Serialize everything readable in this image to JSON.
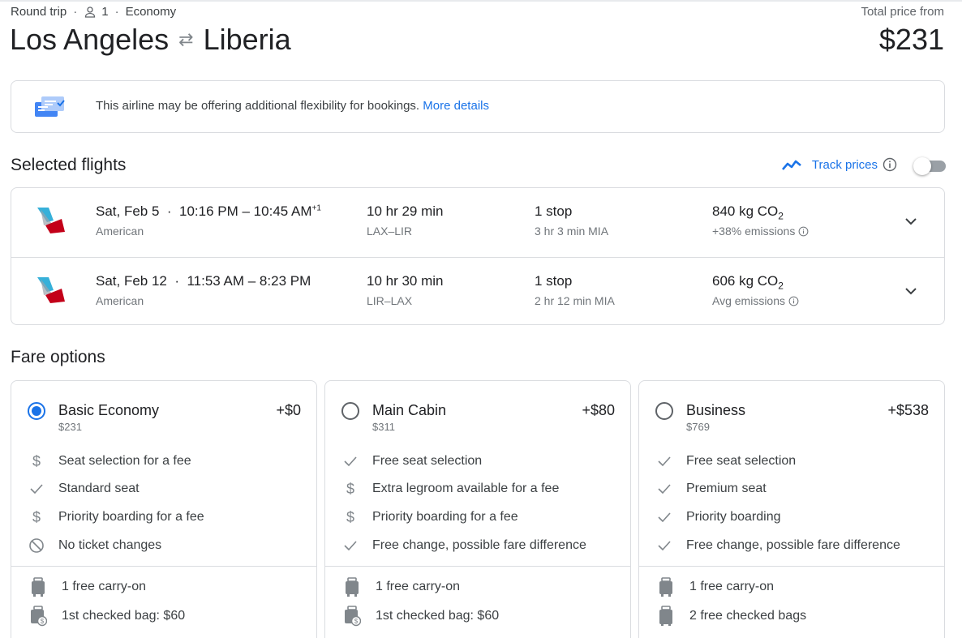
{
  "header": {
    "trip_type": "Round trip",
    "passengers": "1",
    "cabin": "Economy",
    "origin": "Los Angeles",
    "destination": "Liberia",
    "total_label": "Total price from",
    "total_price": "$231"
  },
  "banner": {
    "text": "This airline may be offering additional flexibility for bookings.",
    "link": "More details"
  },
  "selected_flights": {
    "title": "Selected flights",
    "track_label": "Track prices",
    "track_enabled": false,
    "flights": [
      {
        "date": "Sat, Feb 5",
        "times": "10:16 PM – 10:45 AM",
        "day_offset": "+1",
        "airline": "American",
        "duration": "10 hr 29 min",
        "route": "LAX–LIR",
        "stops": "1 stop",
        "layover": "3 hr 3 min MIA",
        "emissions_value": "840 kg CO",
        "emissions_sub": "2",
        "emissions_note": "+38% emissions"
      },
      {
        "date": "Sat, Feb 12",
        "times": "11:53 AM – 8:23 PM",
        "day_offset": "",
        "airline": "American",
        "duration": "10 hr 30 min",
        "route": "LIR–LAX",
        "stops": "1 stop",
        "layover": "2 hr 12 min MIA",
        "emissions_value": "606 kg CO",
        "emissions_sub": "2",
        "emissions_note": "Avg emissions"
      }
    ]
  },
  "fare_options": {
    "title": "Fare options",
    "fares": [
      {
        "name": "Basic Economy",
        "price": "$231",
        "delta": "+$0",
        "selected": true,
        "features": [
          {
            "icon": "dollar-icon",
            "text": "Seat selection for a fee"
          },
          {
            "icon": "check-icon",
            "text": "Standard seat"
          },
          {
            "icon": "dollar-icon",
            "text": "Priority boarding for a fee"
          },
          {
            "icon": "no-icon",
            "text": "No ticket changes"
          }
        ],
        "bags": [
          {
            "icon": "carry-on-icon",
            "text": "1 free carry-on"
          },
          {
            "icon": "checked-bag-fee-icon",
            "text": "1st checked bag: $60"
          }
        ]
      },
      {
        "name": "Main Cabin",
        "price": "$311",
        "delta": "+$80",
        "selected": false,
        "features": [
          {
            "icon": "check-icon",
            "text": "Free seat selection"
          },
          {
            "icon": "dollar-icon",
            "text": "Extra legroom available for a fee"
          },
          {
            "icon": "dollar-icon",
            "text": "Priority boarding for a fee"
          },
          {
            "icon": "check-icon",
            "text": "Free change, possible fare difference"
          }
        ],
        "bags": [
          {
            "icon": "carry-on-icon",
            "text": "1 free carry-on"
          },
          {
            "icon": "checked-bag-fee-icon",
            "text": "1st checked bag: $60"
          }
        ]
      },
      {
        "name": "Business",
        "price": "$769",
        "delta": "+$538",
        "selected": false,
        "features": [
          {
            "icon": "check-icon",
            "text": "Free seat selection"
          },
          {
            "icon": "check-icon",
            "text": "Premium seat"
          },
          {
            "icon": "check-icon",
            "text": "Priority boarding"
          },
          {
            "icon": "check-icon",
            "text": "Free change, possible fare difference"
          }
        ],
        "bags": [
          {
            "icon": "carry-on-icon",
            "text": "1 free carry-on"
          },
          {
            "icon": "checked-bag-icon",
            "text": "2 free checked bags"
          }
        ]
      }
    ]
  },
  "colors": {
    "accent": "#1a73e8",
    "text": "#202124",
    "muted": "#70757a",
    "border": "#dadce0",
    "airline_red": "#c30019",
    "airline_blue": "#36b0d9"
  }
}
